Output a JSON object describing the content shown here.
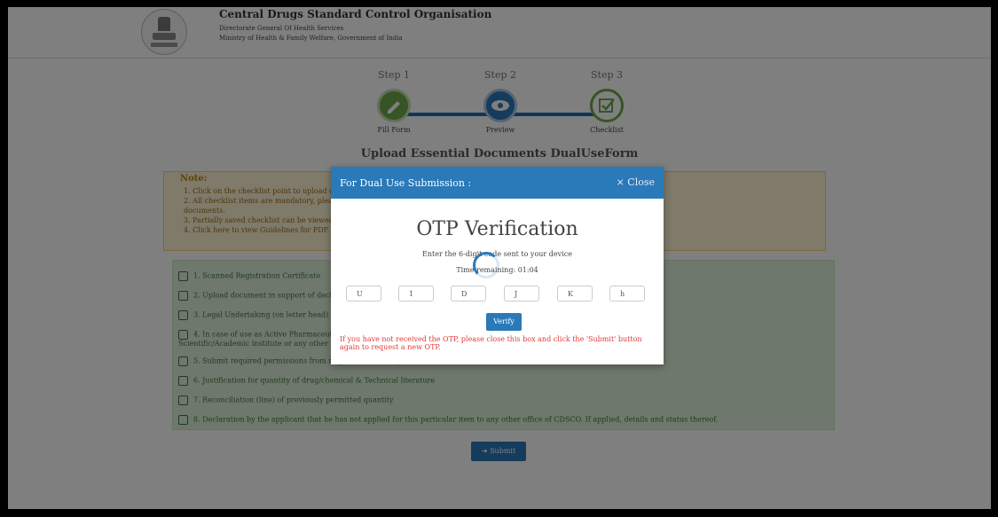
{
  "header": {
    "org_title": "Central Drugs Standard Control Organisation",
    "sub_line_1": "Directorate General Of Health Services",
    "sub_line_2": "Ministry of Health & Family Welfare, Government of India"
  },
  "steps": [
    {
      "label": "Step 1",
      "caption": "Fill Form",
      "icon": "pencil-icon"
    },
    {
      "label": "Step 2",
      "caption": "Preview",
      "icon": "eye-icon"
    },
    {
      "label": "Step 3",
      "caption": "Checklist",
      "icon": "check-square-icon"
    }
  ],
  "page_title": "Upload Essential Documents DualUseForm",
  "note": {
    "title": "Note:",
    "lines": [
      "1. Click on the checklist point to upload documents.",
      "2. All checklist items are mandatory, please upload required documents and also upload supporting",
      "   documents.",
      "3. Partially saved checklist can be viewed.",
      "4. Click here to view Guidelines for PDF."
    ]
  },
  "checklist": [
    "1. Scanned Registration Certificate",
    "2. Upload document in support of declaration",
    "3. Legal Undertaking (on letter head)",
    "4. In case of use as Active Pharmaceutical Ingredient (API) ... drug product or research purpose or needed authority,",
    "  Scientific/Academic institute or any other ...",
    "5. Submit required permissions from respective authority",
    "6. Justification for quantity of drug/chemical & Technical literature",
    "7. Reconciliation (line) of previously permitted quantity",
    "8. Declaration by the applicant that he has not applied for this particular item to any other office of CDSCO. If applied, details and status thereof."
  ],
  "submit_label": "Submit",
  "modal": {
    "title": "For Dual Use Submission :",
    "close_label": "× Close",
    "heading": "OTP Verification",
    "instruction": "Enter the 6-digit code sent to your device",
    "timer_text": "Time remaining: 01:04",
    "otp_digits": [
      "U",
      "1",
      "D",
      "J",
      "K",
      "h"
    ],
    "verify_label": "Verify",
    "message": "If you have not received the OTP, please close this box and click the 'Submit' button again to request a new OTP."
  },
  "colors": {
    "primary": "#2a79b8",
    "success": "#6ca84a",
    "warning_bg": "#fff4d4",
    "error_text": "#e03b3b"
  }
}
